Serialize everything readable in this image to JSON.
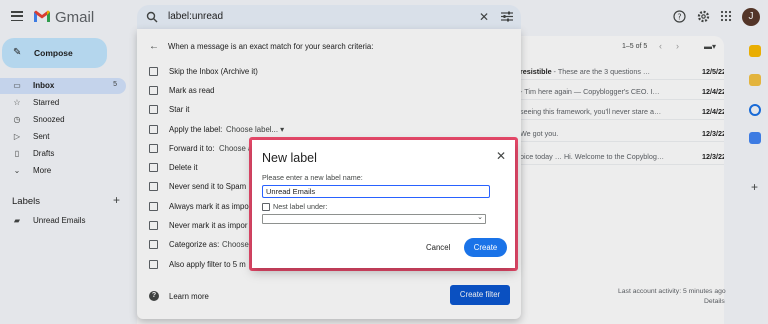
{
  "app": {
    "brand": "Gmail",
    "avatar_initial": "J",
    "icons": [
      "menu-icon",
      "search-icon",
      "clear-icon",
      "tune-icon",
      "help-icon",
      "settings-icon"
    ]
  },
  "search": {
    "value": "label:unread"
  },
  "nav": {
    "compose_label": "Compose",
    "items": [
      {
        "label": "Inbox",
        "count": "5",
        "icon": "inbox-icon"
      },
      {
        "label": "Starred",
        "icon": "star-icon"
      },
      {
        "label": "Snoozed",
        "icon": "clock-icon"
      },
      {
        "label": "Sent",
        "icon": "send-icon"
      },
      {
        "label": "Drafts",
        "icon": "draft-icon"
      },
      {
        "label": "More",
        "icon": "chevron-down-icon"
      }
    ],
    "labels_header": "Labels",
    "labels": [
      {
        "label": "Unread Emails",
        "icon": "label-icon"
      }
    ]
  },
  "mail": {
    "pager": "1–5 of 5",
    "rows": [
      {
        "subject": "resistible",
        "snippet": " - These are the 3 questions …",
        "date": "12/5/22"
      },
      {
        "subject": "",
        "snippet": "- Tim here again — Copyblogger's CEO. I…",
        "date": "12/4/22"
      },
      {
        "subject": "",
        "snippet": "seeing this framework, you'll never stare a…",
        "date": "12/4/22"
      },
      {
        "subject": "",
        "snippet": "We got you.",
        "date": "12/3/22"
      },
      {
        "subject": "",
        "snippet": "oice today … Hi. Welcome to the Copyblog…",
        "date": "12/3/22"
      }
    ],
    "activity": "Last account activity: 5 minutes ago",
    "details": "Details"
  },
  "filter": {
    "title": "When a message is an exact match for your search criteria:",
    "options": [
      {
        "label": "Skip the Inbox (Archive it)",
        "extra": ""
      },
      {
        "label": "Mark as read",
        "extra": ""
      },
      {
        "label": "Star it",
        "extra": ""
      },
      {
        "label": "Apply the label:",
        "extra": "Choose label... ▾"
      },
      {
        "label": "Forward it to:",
        "extra": "Choose a"
      },
      {
        "label": "Delete it",
        "extra": ""
      },
      {
        "label": "Never send it to Spam",
        "extra": ""
      },
      {
        "label": "Always mark it as impo",
        "extra": ""
      },
      {
        "label": "Never mark it as impor",
        "extra": ""
      },
      {
        "label": "Categorize as:",
        "extra": "Choose"
      },
      {
        "label": "Also apply filter to 5 m",
        "extra": ""
      }
    ],
    "learn_more": "Learn more",
    "create_filter": "Create filter"
  },
  "dialog": {
    "title": "New label",
    "prompt": "Please enter a new label name:",
    "input_value": "Unread Emails",
    "nest_label": "Nest label under:",
    "cancel": "Cancel",
    "create": "Create"
  },
  "colors": {
    "accent": "#1a73e8",
    "highlight": "#e8496a",
    "compose_bg": "#c2e7ff"
  }
}
